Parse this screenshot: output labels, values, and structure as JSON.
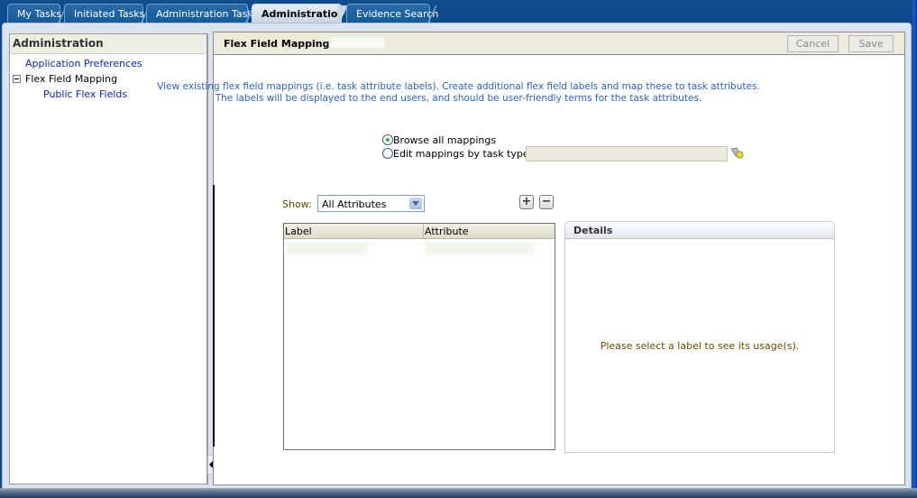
{
  "tabs": [
    {
      "label": "My Tasks",
      "active": false
    },
    {
      "label": "Initiated Tasks",
      "active": false
    },
    {
      "label": "Administration Tasks",
      "active": false
    },
    {
      "label": "Administration",
      "active": true
    },
    {
      "label": "Evidence Search",
      "active": false
    }
  ],
  "sidebar": {
    "title": "Administration",
    "items": [
      {
        "label": "Application Preferences",
        "type": "link"
      },
      {
        "label": "Flex Field Mapping",
        "type": "node",
        "expanded": true
      },
      {
        "label": "Public Flex Fields",
        "type": "link"
      }
    ]
  },
  "main": {
    "title": "Flex Field Mapping",
    "cancel_label": "Cancel",
    "save_label": "Save",
    "intro_line1": "View existing flex field mappings (i.e. task attribute labels). Create additional flex field labels and map these to task attributes.",
    "intro_line2": "The labels will be displayed to the end users, and should be user-friendly terms for the task attributes.",
    "mode_options": [
      {
        "label": "Browse all mappings",
        "selected": true
      },
      {
        "label": "Edit mappings by task type:",
        "selected": false
      }
    ],
    "task_type_value": "",
    "show_label": "Show:",
    "show_value": "All Attributes",
    "add_icon": "plus-icon",
    "remove_icon": "minus-icon",
    "grid": {
      "columns": [
        "Label",
        "Attribute"
      ]
    },
    "details": {
      "title": "Details",
      "message": "Please select a label to see its usage(s)."
    }
  }
}
